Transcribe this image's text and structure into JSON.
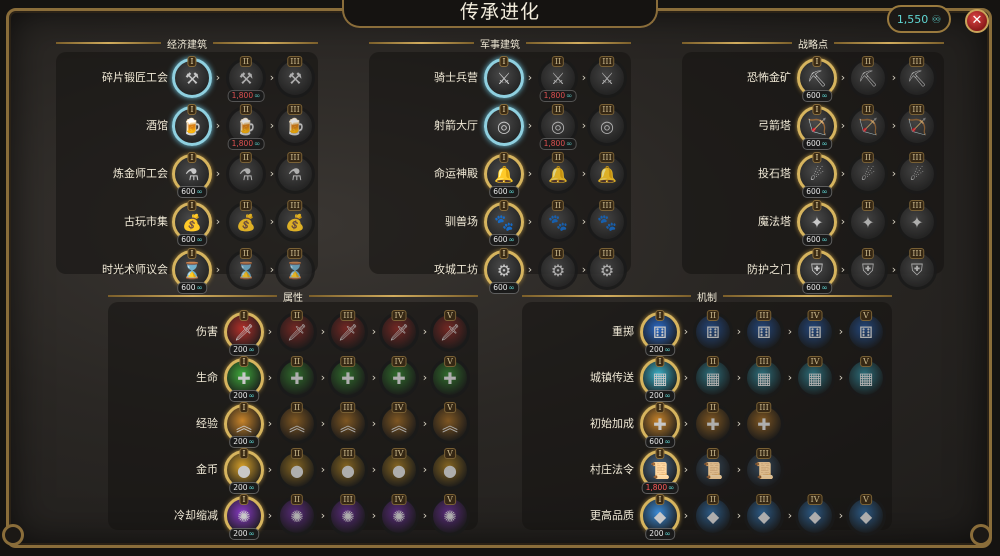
{
  "title": "传承进化",
  "currency": {
    "amount": "1,550",
    "icon": "gem-icon"
  },
  "close_label": "✕",
  "sections": {
    "economy": {
      "title": "经济建筑",
      "rows": [
        {
          "label": "碎片锻匠工会",
          "icon": "anvil-icon",
          "glyph": "⚒",
          "state": "owned",
          "cost": "",
          "next_cost": "1,800",
          "next_cost_red": true
        },
        {
          "label": "酒馆",
          "icon": "tankard-icon",
          "glyph": "🍺",
          "state": "owned",
          "cost": "",
          "next_cost": "1,800",
          "next_cost_red": true
        },
        {
          "label": "炼金师工会",
          "icon": "flask-icon",
          "glyph": "⚗",
          "state": "avail",
          "cost": "600",
          "next_cost": "",
          "next_cost_red": false
        },
        {
          "label": "古玩市集",
          "icon": "bag-icon",
          "glyph": "💰",
          "state": "avail",
          "cost": "600",
          "next_cost": "",
          "next_cost_red": false
        },
        {
          "label": "时光术师议会",
          "icon": "hourglass-icon",
          "glyph": "⌛",
          "state": "avail",
          "cost": "600",
          "next_cost": "",
          "next_cost_red": false
        }
      ]
    },
    "military": {
      "title": "军事建筑",
      "rows": [
        {
          "label": "骑士兵营",
          "icon": "crossed-swords-icon",
          "glyph": "⚔",
          "state": "owned",
          "cost": "",
          "next_cost": "1,800",
          "next_cost_red": true
        },
        {
          "label": "射箭大厅",
          "icon": "target-icon",
          "glyph": "◎",
          "state": "owned",
          "cost": "",
          "next_cost": "1,800",
          "next_cost_red": true
        },
        {
          "label": "命运神殿",
          "icon": "bell-icon",
          "glyph": "🔔",
          "state": "avail",
          "cost": "600",
          "next_cost": "",
          "next_cost_red": false
        },
        {
          "label": "驯兽场",
          "icon": "beast-icon",
          "glyph": "🐾",
          "state": "avail",
          "cost": "600",
          "next_cost": "",
          "next_cost_red": false
        },
        {
          "label": "攻城工坊",
          "icon": "gear-icon",
          "glyph": "⚙",
          "state": "avail",
          "cost": "600",
          "next_cost": "",
          "next_cost_red": false
        }
      ]
    },
    "strategy": {
      "title": "战略点",
      "rows": [
        {
          "label": "恐怖金矿",
          "icon": "mine-icon",
          "glyph": "⛏",
          "state": "avail",
          "cost": "600"
        },
        {
          "label": "弓箭塔",
          "icon": "bow-tower-icon",
          "glyph": "🏹",
          "state": "avail",
          "cost": "600"
        },
        {
          "label": "投石塔",
          "icon": "catapult-icon",
          "glyph": "☄",
          "state": "avail",
          "cost": "600"
        },
        {
          "label": "魔法塔",
          "icon": "magic-tower-icon",
          "glyph": "✦",
          "state": "avail",
          "cost": "600"
        },
        {
          "label": "防护之门",
          "icon": "gate-icon",
          "glyph": "⛨",
          "state": "avail",
          "cost": "600"
        }
      ]
    },
    "attributes": {
      "title": "属性",
      "rows": [
        {
          "label": "伤害",
          "icon": "sword-icon",
          "glyph": "🗡",
          "color": "#b4302a",
          "cost": "200"
        },
        {
          "label": "生命",
          "icon": "health-cross-icon",
          "glyph": "✚",
          "color": "#3ea83a",
          "cost": "200"
        },
        {
          "label": "经验",
          "icon": "chevron-rank-icon",
          "glyph": "︽",
          "color": "#c8842a",
          "cost": "200"
        },
        {
          "label": "金币",
          "icon": "coins-icon",
          "glyph": "●",
          "color": "#d6a02a",
          "cost": "200"
        },
        {
          "label": "冷却缩减",
          "icon": "spiral-icon",
          "glyph": "✺",
          "color": "#8a3ac8",
          "cost": "200"
        }
      ]
    },
    "mechanics": {
      "title": "机制",
      "rows": [
        {
          "label": "重掷",
          "icon": "dice-icon",
          "glyph": "⚅",
          "color": "#2a6ac8",
          "cost": "200",
          "levels": 5
        },
        {
          "label": "城镇传送",
          "icon": "portal-icon",
          "glyph": "▦",
          "color": "#3ab0c8",
          "cost": "200",
          "levels": 5
        },
        {
          "label": "初始加成",
          "icon": "plus-icon",
          "glyph": "✚",
          "color": "#c8842a",
          "cost": "600",
          "levels": 3
        },
        {
          "label": "村庄法令",
          "icon": "scroll-icon",
          "glyph": "📜",
          "color": "#4a6a8a",
          "cost": "1,800",
          "cost_red": true,
          "levels": 3
        },
        {
          "label": "更高品质",
          "icon": "crystal-icon",
          "glyph": "◆",
          "color": "#3a8ad6",
          "cost": "200",
          "levels": 5
        }
      ]
    }
  },
  "roman": [
    "I",
    "II",
    "III",
    "IV",
    "V"
  ],
  "colors": {
    "accent": "#d6b45e",
    "gem": "#5fd6d2",
    "cost_red": "#ff5a5a",
    "owned_ring": "#8fd0e0"
  }
}
